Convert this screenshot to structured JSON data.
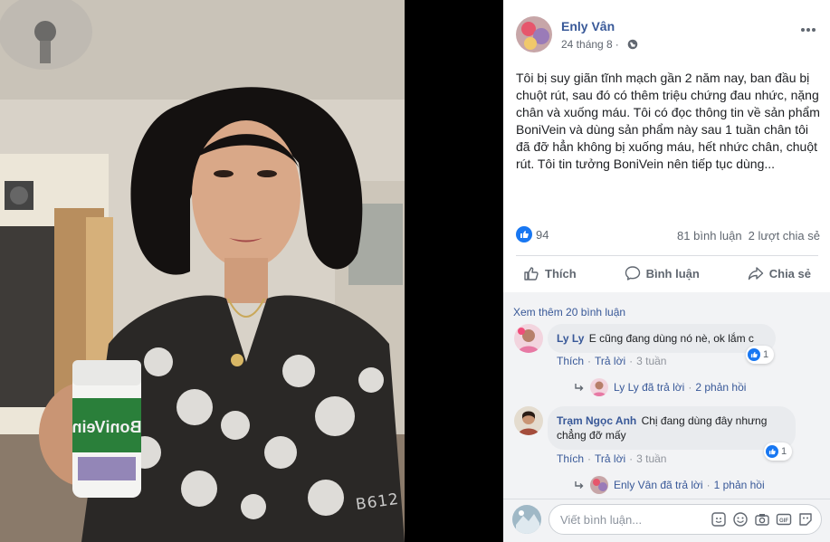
{
  "photo": {
    "watermark": "B612"
  },
  "post": {
    "author": "Enly Vân",
    "date": "24 tháng 8",
    "text": "Tôi bị suy giãn tĩnh mạch gần 2 năm nay, ban đầu bị chuột rút, sau đó có thêm triệu chứng đau nhức, nặng chân và xuống máu. Tôi có đọc thông tin về sản phẩm BoniVein và dùng sản phẩm này sau 1 tuần chân tôi đã đỡ hẳn không bị xuống máu, hết nhức chân, chuột rút. Tôi tin tưởng BoniVein nên tiếp tục dùng...",
    "reactions": "94",
    "comment_count": "81 bình luận",
    "share_count": "2 lượt chia sẻ"
  },
  "actions": {
    "like": "Thích",
    "comment": "Bình luận",
    "share": "Chia sẻ"
  },
  "comments": {
    "see_more": "Xem thêm 20 bình luận",
    "items": [
      {
        "name": "Ly Ly",
        "text": "E cũng đang dùng nó nè, ok lắm c",
        "likes": "1",
        "like_label": "Thích",
        "reply_label": "Trả lời",
        "time": "3 tuần",
        "replied_by": "Ly Ly đã trả lời",
        "reply_count": "2 phản hồi"
      },
      {
        "name": "Trạm Ngọc Anh",
        "text_line1": "Chị đang dùng đây nhưng",
        "text_line2": "chẳng đỡ mấy",
        "likes": "1",
        "like_label": "Thích",
        "reply_label": "Trả lời",
        "time": "3 tuần",
        "replied_by": "Enly Vân đã trả lời",
        "reply_count": "1 phản hồi"
      }
    ]
  },
  "composer": {
    "placeholder": "Viết bình luận..."
  },
  "colors": {
    "link": "#385898",
    "like_blue": "#1877f2",
    "panel_bg": "#ffffff",
    "comment_bg": "#f2f3f5"
  }
}
